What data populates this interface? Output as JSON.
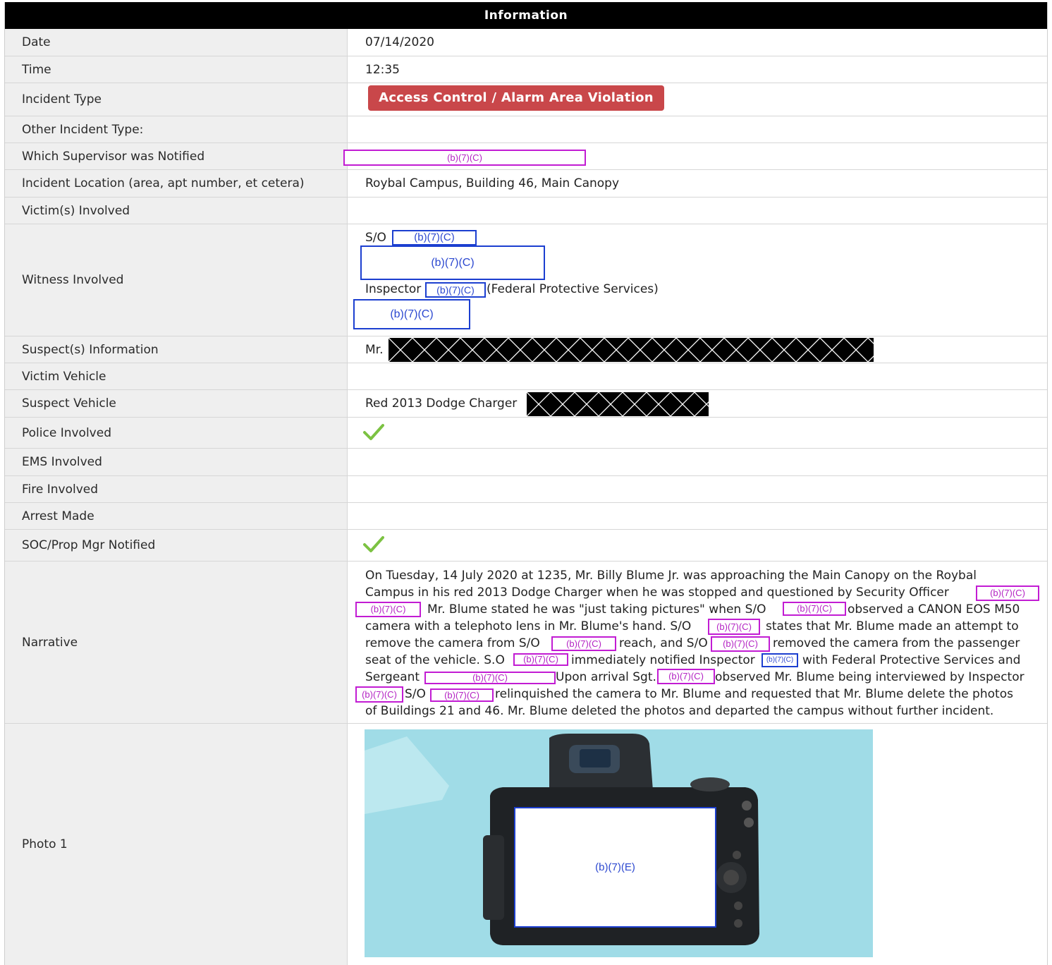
{
  "header": {
    "title": "Information"
  },
  "rows": {
    "date": {
      "label": "Date",
      "value": "07/14/2020"
    },
    "time": {
      "label": "Time",
      "value": "12:35"
    },
    "incident_type": {
      "label": "Incident Type",
      "value": "Access Control / Alarm Area Violation"
    },
    "other_type": {
      "label": "Other Incident Type:",
      "value": ""
    },
    "supervisor": {
      "label": "Which Supervisor was Notified",
      "redaction": "(b)(7)(C)"
    },
    "location": {
      "label": "Incident Location (area, apt number, et cetera)",
      "value": "Roybal Campus, Building 46, Main Canopy"
    },
    "victims": {
      "label": "Victim(s) Involved",
      "value": ""
    },
    "witness": {
      "label": "Witness Involved",
      "line1_prefix": "S/O",
      "line3_prefix": "Inspector",
      "line3_suffix": "(Federal Protective Services)",
      "redaction": "(b)(7)(C)"
    },
    "suspect_info": {
      "label": "Suspect(s) Information",
      "value": "Mr."
    },
    "victim_vehicle": {
      "label": "Victim Vehicle",
      "value": ""
    },
    "suspect_vehicle": {
      "label": "Suspect Vehicle",
      "value": "Red 2013 Dodge Charger"
    },
    "police": {
      "label": "Police Involved",
      "checked": true
    },
    "ems": {
      "label": "EMS Involved",
      "value": ""
    },
    "fire": {
      "label": "Fire Involved",
      "value": ""
    },
    "arrest": {
      "label": "Arrest Made",
      "value": ""
    },
    "soc": {
      "label": "SOC/Prop Mgr Notified",
      "checked": true
    },
    "narrative": {
      "label": "Narrative",
      "redaction": "(b)(7)(C)",
      "l1": "On Tuesday, 14 July 2020 at 1235, Mr. Billy Blume Jr. was approaching the Main Canopy on the Roybal",
      "l2": "Campus in his red 2013 Dodge Charger when he was stopped and questioned by Security Officer",
      "l3a": "Mr. Blume stated he was \"just taking pictures\" when S/O",
      "l3b": "observed a CANON EOS M50",
      "l4a": "camera with a telephoto lens in Mr. Blume's hand. S/O",
      "l4b": "states that Mr. Blume made an attempt to",
      "l5a": "remove the camera from S/O",
      "l5b": "reach, and S/O",
      "l5c": "removed the camera from the passenger",
      "l6a": "seat of the vehicle. S.O",
      "l6b": "immediately notified Inspector",
      "l6c": "with Federal Protective Services and",
      "l7a": "Sergeant",
      "l7b": "Upon arrival Sgt.",
      "l7c": "observed Mr. Blume being interviewed by Inspector",
      "l8a": "S/O",
      "l8b": "relinquished the camera to Mr. Blume and requested that Mr. Blume delete the photos",
      "l9": "of Buildings 21 and 46. Mr. Blume deleted the photos and departed the campus without further incident."
    },
    "photo": {
      "label": "Photo 1",
      "redaction": "(b)(7)(E)"
    }
  },
  "colors": {
    "header_bg": "#000000",
    "badge_bg": "#c9474a",
    "redact_magenta": "#c21cd3",
    "redact_blue": "#1c3fd0",
    "check": "#7cc242"
  }
}
